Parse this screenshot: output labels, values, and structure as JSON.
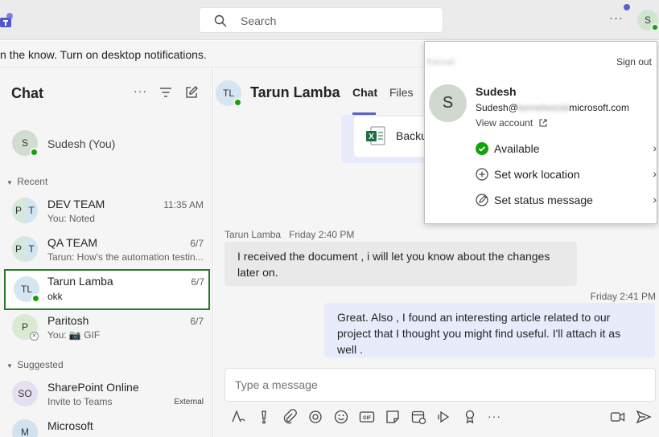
{
  "search": {
    "placeholder": "Search"
  },
  "topbar": {
    "more": "···",
    "avatar_initial": "S"
  },
  "notification": {
    "text": "n the know. Turn on desktop notifications."
  },
  "sidebar": {
    "title": "Chat",
    "self": {
      "name": "Sudesh (You)",
      "initial": "S"
    },
    "recent_label": "Recent",
    "suggested_label": "Suggested",
    "chats": [
      {
        "name": "DEV TEAM",
        "sub": "You: Noted",
        "time": "11:35 AM",
        "a": "P",
        "b": "T"
      },
      {
        "name": "QA TEAM",
        "sub": "Tarun: How's the automation testin...",
        "time": "6/7",
        "a": "P",
        "b": "T"
      },
      {
        "name": "Tarun Lamba",
        "sub": "okk",
        "time": "6/7",
        "initials": "TL"
      },
      {
        "name": "Paritosh",
        "sub": "You: 📷 GIF",
        "time": "6/7",
        "initial": "P"
      }
    ],
    "suggested": [
      {
        "name": "SharePoint Online",
        "sub": "Invite to Teams",
        "tag": "External",
        "initials": "SO"
      },
      {
        "name": "Microsoft",
        "initial": "M"
      }
    ]
  },
  "chat": {
    "contact_initials": "TL",
    "contact_name": "Tarun Lamba",
    "tabs": [
      "Chat",
      "Files"
    ],
    "file_name": "Backu",
    "msg1_sender": "Tarun Lamba",
    "msg1_time": "Friday 2:40 PM",
    "msg1_text": "I received the document , i will let you know about the changes later on.",
    "msg2_time": "Friday 2:41 PM",
    "msg2_text": "Great. Also , I found an interesting article related to our project that I thought you might find useful. I'll attach it as well .",
    "composer_placeholder": "Type a message"
  },
  "profile": {
    "org": "Kernel",
    "sign_out": "Sign out",
    "initial": "S",
    "name": "Sudesh",
    "email_prefix": "Sudesh@",
    "email_hidden": "kernelsocial",
    "email_suffix": "microsoft.com",
    "view_account": "View account",
    "items": [
      "Available",
      "Set work location",
      "Set status message"
    ]
  },
  "colors": {
    "accent": "#5b5fc7",
    "available": "#13a10e",
    "selected_border": "#2a7a2a"
  }
}
